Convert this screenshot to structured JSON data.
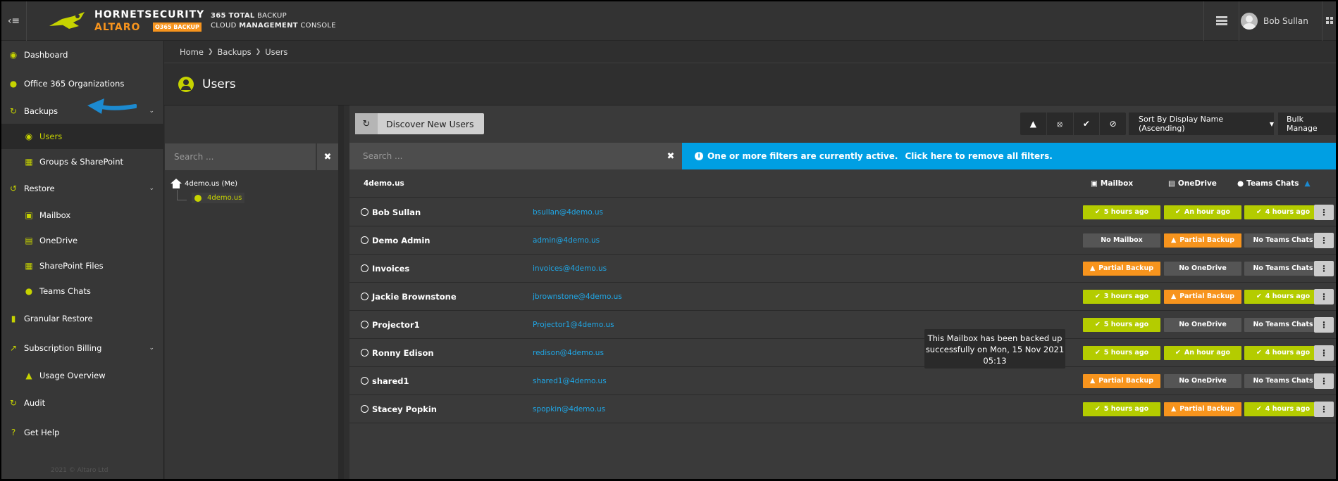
{
  "header": {
    "brand_top": "HORNETSECURITY",
    "brand_bottom": "ALTARO",
    "brand_badge": "O365 BACKUP",
    "product_line1_bold": "365 TOTAL",
    "product_line1_rest": " BACKUP",
    "product_line2_pre": "CLOUD ",
    "product_line2_bold": "MANAGEMENT",
    "product_line2_post": " CONSOLE",
    "user_name": "Bob Sullan"
  },
  "sidebar": {
    "dashboard": "Dashboard",
    "office365": "Office 365 Organizations",
    "backups": "Backups",
    "users": "Users",
    "groups": "Groups & SharePoint",
    "restore": "Restore",
    "mailbox": "Mailbox",
    "onedrive": "OneDrive",
    "sharepoint_files": "SharePoint Files",
    "teams_chats": "Teams Chats",
    "granular": "Granular Restore",
    "billing": "Subscription Billing",
    "usage": "Usage Overview",
    "audit": "Audit",
    "help": "Get Help",
    "footer": "2021 © Altaro Ltd"
  },
  "breadcrumb": {
    "home": "Home",
    "backups": "Backups",
    "users": "Users"
  },
  "page_title": "Users",
  "tree": {
    "search_placeholder": "Search ...",
    "root": "4demo.us (Me)",
    "child": "4demo.us"
  },
  "toolbar": {
    "discover": "Discover New Users",
    "sort": "Sort By Display Name (Ascending)",
    "bulk": "Bulk Manage"
  },
  "search_placeholder": "Search ...",
  "filter_banner": {
    "message": "One or more filters are currently active.",
    "link": "Click here to remove all filters."
  },
  "table": {
    "tenant": "4demo.us",
    "col_mailbox": "Mailbox",
    "col_onedrive": "OneDrive",
    "col_teams": "Teams Chats",
    "rows": [
      {
        "name": "Bob Sullan",
        "email": "bsullan@4demo.us",
        "mailbox": "5 hours ago",
        "mailbox_status": "ok",
        "onedrive": "An hour ago",
        "onedrive_status": "ok",
        "teams": "4 hours ago",
        "teams_status": "ok"
      },
      {
        "name": "Demo Admin",
        "email": "admin@4demo.us",
        "mailbox": "No Mailbox",
        "mailbox_status": "none",
        "onedrive": "Partial Backup",
        "onedrive_status": "warn",
        "teams": "No Teams Chats",
        "teams_status": "none"
      },
      {
        "name": "Invoices",
        "email": "invoices@4demo.us",
        "mailbox": "Partial Backup",
        "mailbox_status": "warn",
        "onedrive": "No OneDrive",
        "onedrive_status": "none",
        "teams": "No Teams Chats",
        "teams_status": "none"
      },
      {
        "name": "Jackie Brownstone",
        "email": "jbrownstone@4demo.us",
        "mailbox": "3 hours ago",
        "mailbox_status": "ok",
        "onedrive": "Partial Backup",
        "onedrive_status": "warn",
        "teams": "4 hours ago",
        "teams_status": "ok"
      },
      {
        "name": "Projector1",
        "email": "Projector1@4demo.us",
        "mailbox": "5 hours ago",
        "mailbox_status": "ok",
        "onedrive": "No OneDrive",
        "onedrive_status": "none",
        "teams": "No Teams Chats",
        "teams_status": "none"
      },
      {
        "name": "Ronny Edison",
        "email": "redison@4demo.us",
        "mailbox": "5 hours ago",
        "mailbox_status": "ok",
        "onedrive": "An hour ago",
        "onedrive_status": "ok",
        "teams": "4 hours ago",
        "teams_status": "ok"
      },
      {
        "name": "shared1",
        "email": "shared1@4demo.us",
        "mailbox": "Partial Backup",
        "mailbox_status": "warn",
        "onedrive": "No OneDrive",
        "onedrive_status": "none",
        "teams": "No Teams Chats",
        "teams_status": "none"
      },
      {
        "name": "Stacey Popkin",
        "email": "spopkin@4demo.us",
        "mailbox": "5 hours ago",
        "mailbox_status": "ok",
        "onedrive": "Partial Backup",
        "onedrive_status": "warn",
        "teams": "4 hours ago",
        "teams_status": "ok"
      }
    ]
  },
  "tooltip": "This Mailbox has been backed up successfully on Mon, 15 Nov 2021 05:13",
  "colors": {
    "accent": "#c6d300",
    "ok": "#b4cc00",
    "warn": "#f7941d",
    "info": "#009fe3",
    "link": "#1fa8e8"
  }
}
